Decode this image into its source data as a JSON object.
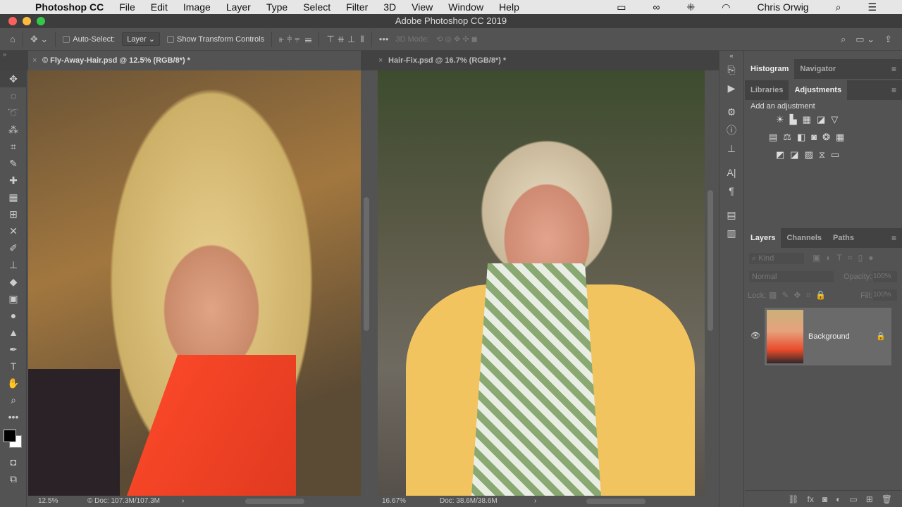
{
  "menubar": {
    "apple": "",
    "app": "Photoshop CC",
    "items": [
      "File",
      "Edit",
      "Image",
      "Layer",
      "Type",
      "Select",
      "Filter",
      "3D",
      "View",
      "Window",
      "Help"
    ],
    "user": "Chris Orwig"
  },
  "window": {
    "title": "Adobe Photoshop CC 2019"
  },
  "options": {
    "auto_select": "Auto-Select:",
    "layer_select": "Layer",
    "show_transform": "Show Transform Controls",
    "mode_3d": "3D Mode:"
  },
  "documents": [
    {
      "tab": "© Fly-Away-Hair.psd @ 12.5% (RGB/8*) *",
      "zoom": "12.5%",
      "doc": "© Doc: 107.3M/107.3M"
    },
    {
      "tab": "Hair-Fix.psd @ 16.7% (RGB/8*) *",
      "zoom": "16.67%",
      "doc": "Doc: 38.6M/38.6M"
    }
  ],
  "panels": {
    "top_tabs": [
      "Histogram",
      "Navigator"
    ],
    "mid_tabs": [
      "Libraries",
      "Adjustments"
    ],
    "add_adjustment": "Add an adjustment",
    "layer_tabs": [
      "Layers",
      "Channels",
      "Paths"
    ],
    "kind": "Kind",
    "blend": "Normal",
    "opacity_label": "Opacity:",
    "opacity": "100%",
    "lock": "Lock:",
    "fill_label": "Fill:",
    "fill": "100%",
    "layers": [
      {
        "name": "Background",
        "visible": true,
        "locked": true
      }
    ]
  }
}
